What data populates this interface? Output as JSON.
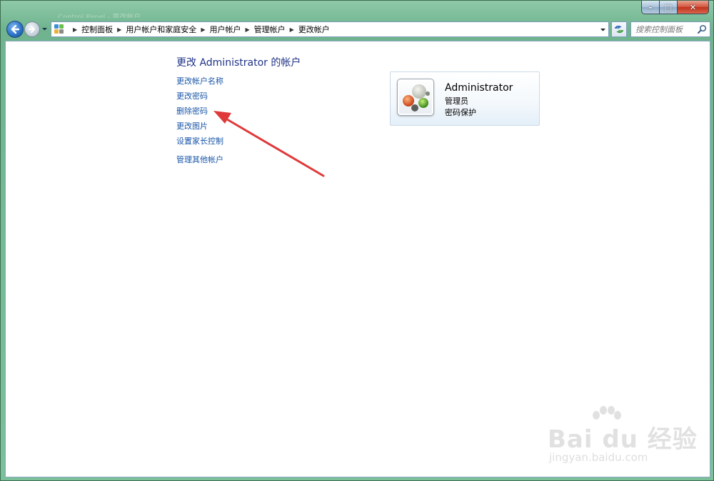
{
  "window": {
    "title": "Control Panel - 更改帐户",
    "controls": {
      "minimize": "–",
      "maximize": "□",
      "close": "✕"
    }
  },
  "nav": {
    "back_icon": "back-arrow-icon",
    "forward_icon": "forward-arrow-icon",
    "breadcrumbs": [
      "控制面板",
      "用户帐户和家庭安全",
      "用户帐户",
      "管理帐户",
      "更改帐户"
    ],
    "search_placeholder": "搜索控制面板"
  },
  "main": {
    "title": "更改 Administrator 的帐户",
    "tasks": [
      {
        "label": "更改帐户名称"
      },
      {
        "label": "更改密码"
      },
      {
        "label": "删除密码"
      },
      {
        "label": "更改图片"
      },
      {
        "label": "设置家长控制"
      },
      {
        "label": "管理其他帐户"
      }
    ]
  },
  "account": {
    "name": "Administrator",
    "role": "管理员",
    "status": "密码保护"
  },
  "annotation": {
    "color": "#e0393a",
    "points_to": "删除密码"
  },
  "watermark": {
    "logo_text": "Bai du 经验",
    "site": "jingyan.baidu.com"
  }
}
